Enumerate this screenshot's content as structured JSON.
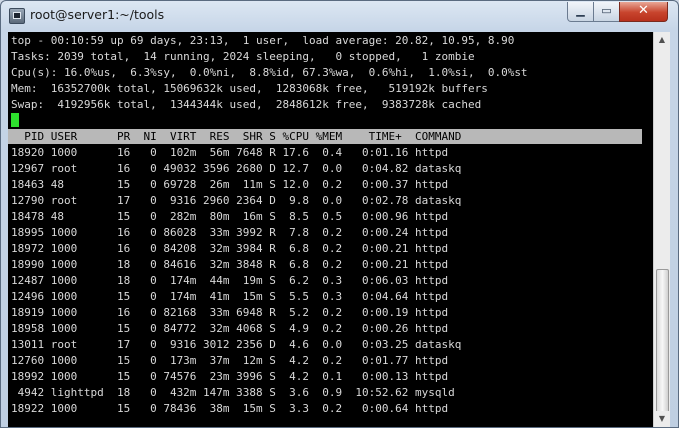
{
  "window": {
    "title": "root@server1:~/tools",
    "min_glyph": "▁",
    "max_glyph": "▭",
    "close_glyph": "✕"
  },
  "summary": [
    "top - 00:10:59 up 69 days, 23:13,  1 user,  load average: 20.82, 10.95, 8.90",
    "Tasks: 2039 total,  14 running, 2024 sleeping,   0 stopped,   1 zombie",
    "Cpu(s): 16.0%us,  6.3%sy,  0.0%ni,  8.8%id, 67.3%wa,  0.6%hi,  1.0%si,  0.0%st",
    "Mem:  16352700k total, 15069632k used,  1283068k free,   519192k buffers",
    "Swap:  4192956k total,  1344344k used,  2848612k free,  9383728k cached"
  ],
  "header": "  PID USER      PR  NI  VIRT  RES  SHR S %CPU %MEM    TIME+  COMMAND",
  "processes": [
    "18920 1000      16   0  102m  56m 7648 R 17.6  0.4   0:01.16 httpd",
    "12967 root      16   0 49032 3596 2680 D 12.7  0.0   0:04.82 dataskq",
    "18463 48        15   0 69728  26m  11m S 12.0  0.2   0:00.37 httpd",
    "12790 root      17   0  9316 2960 2364 D  9.8  0.0   0:02.78 dataskq",
    "18478 48        15   0  282m  80m  16m S  8.5  0.5   0:00.96 httpd",
    "18995 1000      16   0 86028  33m 3992 R  7.8  0.2   0:00.24 httpd",
    "18972 1000      16   0 84208  32m 3984 R  6.8  0.2   0:00.21 httpd",
    "18990 1000      18   0 84616  32m 3848 R  6.8  0.2   0:00.21 httpd",
    "12487 1000      18   0  174m  44m  19m S  6.2  0.3   0:06.03 httpd",
    "12496 1000      15   0  174m  41m  15m S  5.5  0.3   0:04.64 httpd",
    "18919 1000      16   0 82168  33m 6948 R  5.2  0.2   0:00.19 httpd",
    "18958 1000      15   0 84772  32m 4068 S  4.9  0.2   0:00.26 httpd",
    "13011 root      17   0  9316 3012 2356 D  4.6  0.0   0:03.25 dataskq",
    "12760 1000      15   0  173m  37m  12m S  4.2  0.2   0:01.77 httpd",
    "18992 1000      15   0 74576  23m 3996 S  4.2  0.1   0:00.13 httpd",
    " 4942 lighttpd  18   0  432m 147m 3388 S  3.6  0.9  10:52.62 mysqld",
    "18922 1000      15   0 78436  38m  15m S  3.3  0.2   0:00.64 httpd"
  ],
  "scrollbar": {
    "up_glyph": "▲",
    "down_glyph": "▼"
  }
}
